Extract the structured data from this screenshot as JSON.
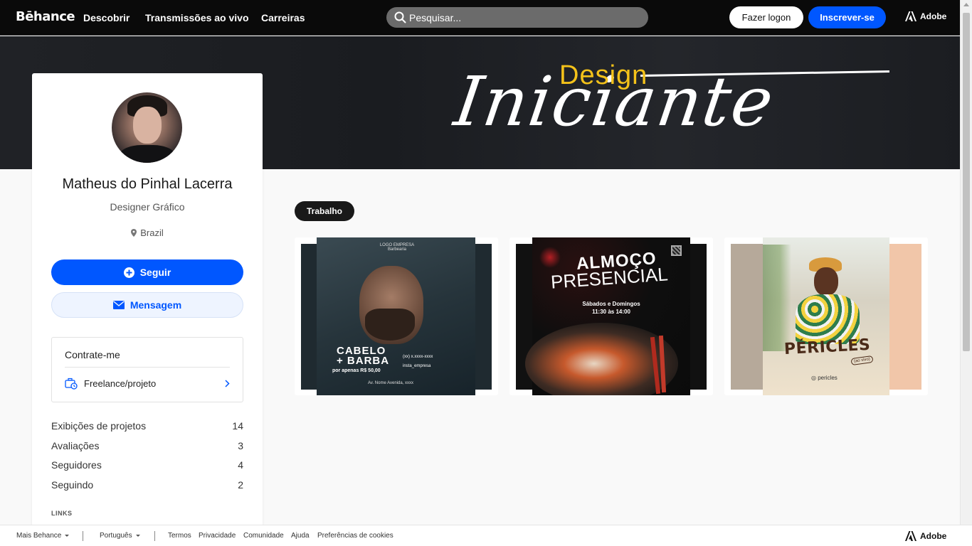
{
  "topbar": {
    "logo": "Bēhance",
    "nav": [
      "Descobrir",
      "Transmissões ao vivo",
      "Carreiras"
    ],
    "search_placeholder": "Pesquisar...",
    "login_label": "Fazer logon",
    "signup_label": "Inscrever-se",
    "adobe_label": "Adobe"
  },
  "banner": {
    "line1": "Design",
    "line2": "Iniciante",
    "line1_color": "#f4c21a"
  },
  "profile": {
    "name": "Matheus do Pinhal Lacerra",
    "role": "Designer Gráfico",
    "location": "Brazil",
    "follow_label": "Seguir",
    "message_label": "Mensagem",
    "hire": {
      "title": "Contrate-me",
      "item_label": "Freelance/projeto"
    },
    "stats": [
      {
        "label": "Exibições de projetos",
        "value": "14"
      },
      {
        "label": "Avaliações",
        "value": "3"
      },
      {
        "label": "Seguidores",
        "value": "4"
      },
      {
        "label": "Seguindo",
        "value": "2"
      }
    ],
    "links_label": "LINKS"
  },
  "main": {
    "tab_label": "Trabalho",
    "projects": [
      {
        "logo_text": "LOGO EMPRESA Barbearia",
        "title_line1": "CABELO",
        "title_line2": "+ BARBA",
        "price": "por apenas R$ 50,00",
        "contact_phone": "(xx) x.xxxx-xxxx",
        "contact_insta": "insta_empresa",
        "address": "Av. Nome Avenida, xxxx"
      },
      {
        "title_line1": "ALMOÇO",
        "title_line2": "PRESENCIAL",
        "days": "Sábados e Domingos",
        "hours": "11:30 às 14:00"
      },
      {
        "name": "PÉRICLES",
        "live": "(ao vivo)",
        "handle": "pericles"
      }
    ]
  },
  "footer": {
    "more_label": "Mais Behance",
    "language_label": "Português",
    "links": [
      "Termos",
      "Privacidade",
      "Comunidade",
      "Ajuda",
      "Preferências de cookies"
    ],
    "adobe_label": "Adobe"
  },
  "colors": {
    "accent_blue": "#0057ff",
    "topbar_bg": "#0a0a0a"
  }
}
